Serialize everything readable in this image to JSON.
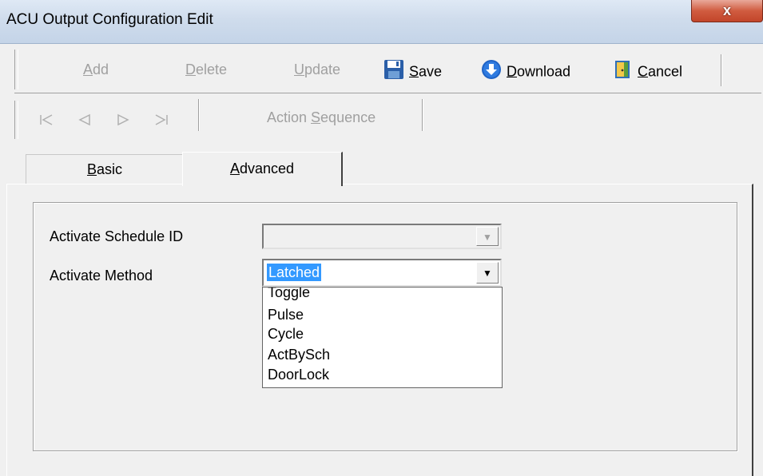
{
  "window": {
    "title": "ACU Output Configuration Edit",
    "close_glyph": "x"
  },
  "toolbar": {
    "add": {
      "pre": "",
      "key": "A",
      "post": "dd"
    },
    "delete": {
      "pre": "",
      "key": "D",
      "post": "elete"
    },
    "update": {
      "pre": "",
      "key": "U",
      "post": "pdate"
    },
    "save": {
      "pre": "",
      "key": "S",
      "post": "ave",
      "icon": "floppy-disk-icon"
    },
    "download": {
      "pre": "",
      "key": "D",
      "post": "ownload",
      "icon": "download-arrow-icon"
    },
    "cancel": {
      "pre": "",
      "key": "C",
      "post": "ancel",
      "icon": "exit-door-icon"
    }
  },
  "navigation": {
    "icons": [
      "first-record-icon",
      "previous-record-icon",
      "next-record-icon",
      "last-record-icon"
    ],
    "action_sequence": {
      "pre": "Action ",
      "key": "S",
      "post": "equence"
    }
  },
  "tabs": {
    "basic": {
      "pre": "",
      "key": "B",
      "post": "asic"
    },
    "advanced": {
      "pre": "",
      "key": "A",
      "post": "dvanced"
    }
  },
  "form": {
    "schedule_label": "Activate Schedule ID",
    "schedule_value": "",
    "method_label": "Activate Method",
    "method_value": "Latched",
    "method_options": [
      "Toggle",
      "Pulse",
      "Cycle",
      "ActBySch",
      "DoorLock"
    ]
  },
  "colors": {
    "selection": "#3399ff",
    "close_button": "#c2452a",
    "disabled_text": "#a0a0a0"
  }
}
